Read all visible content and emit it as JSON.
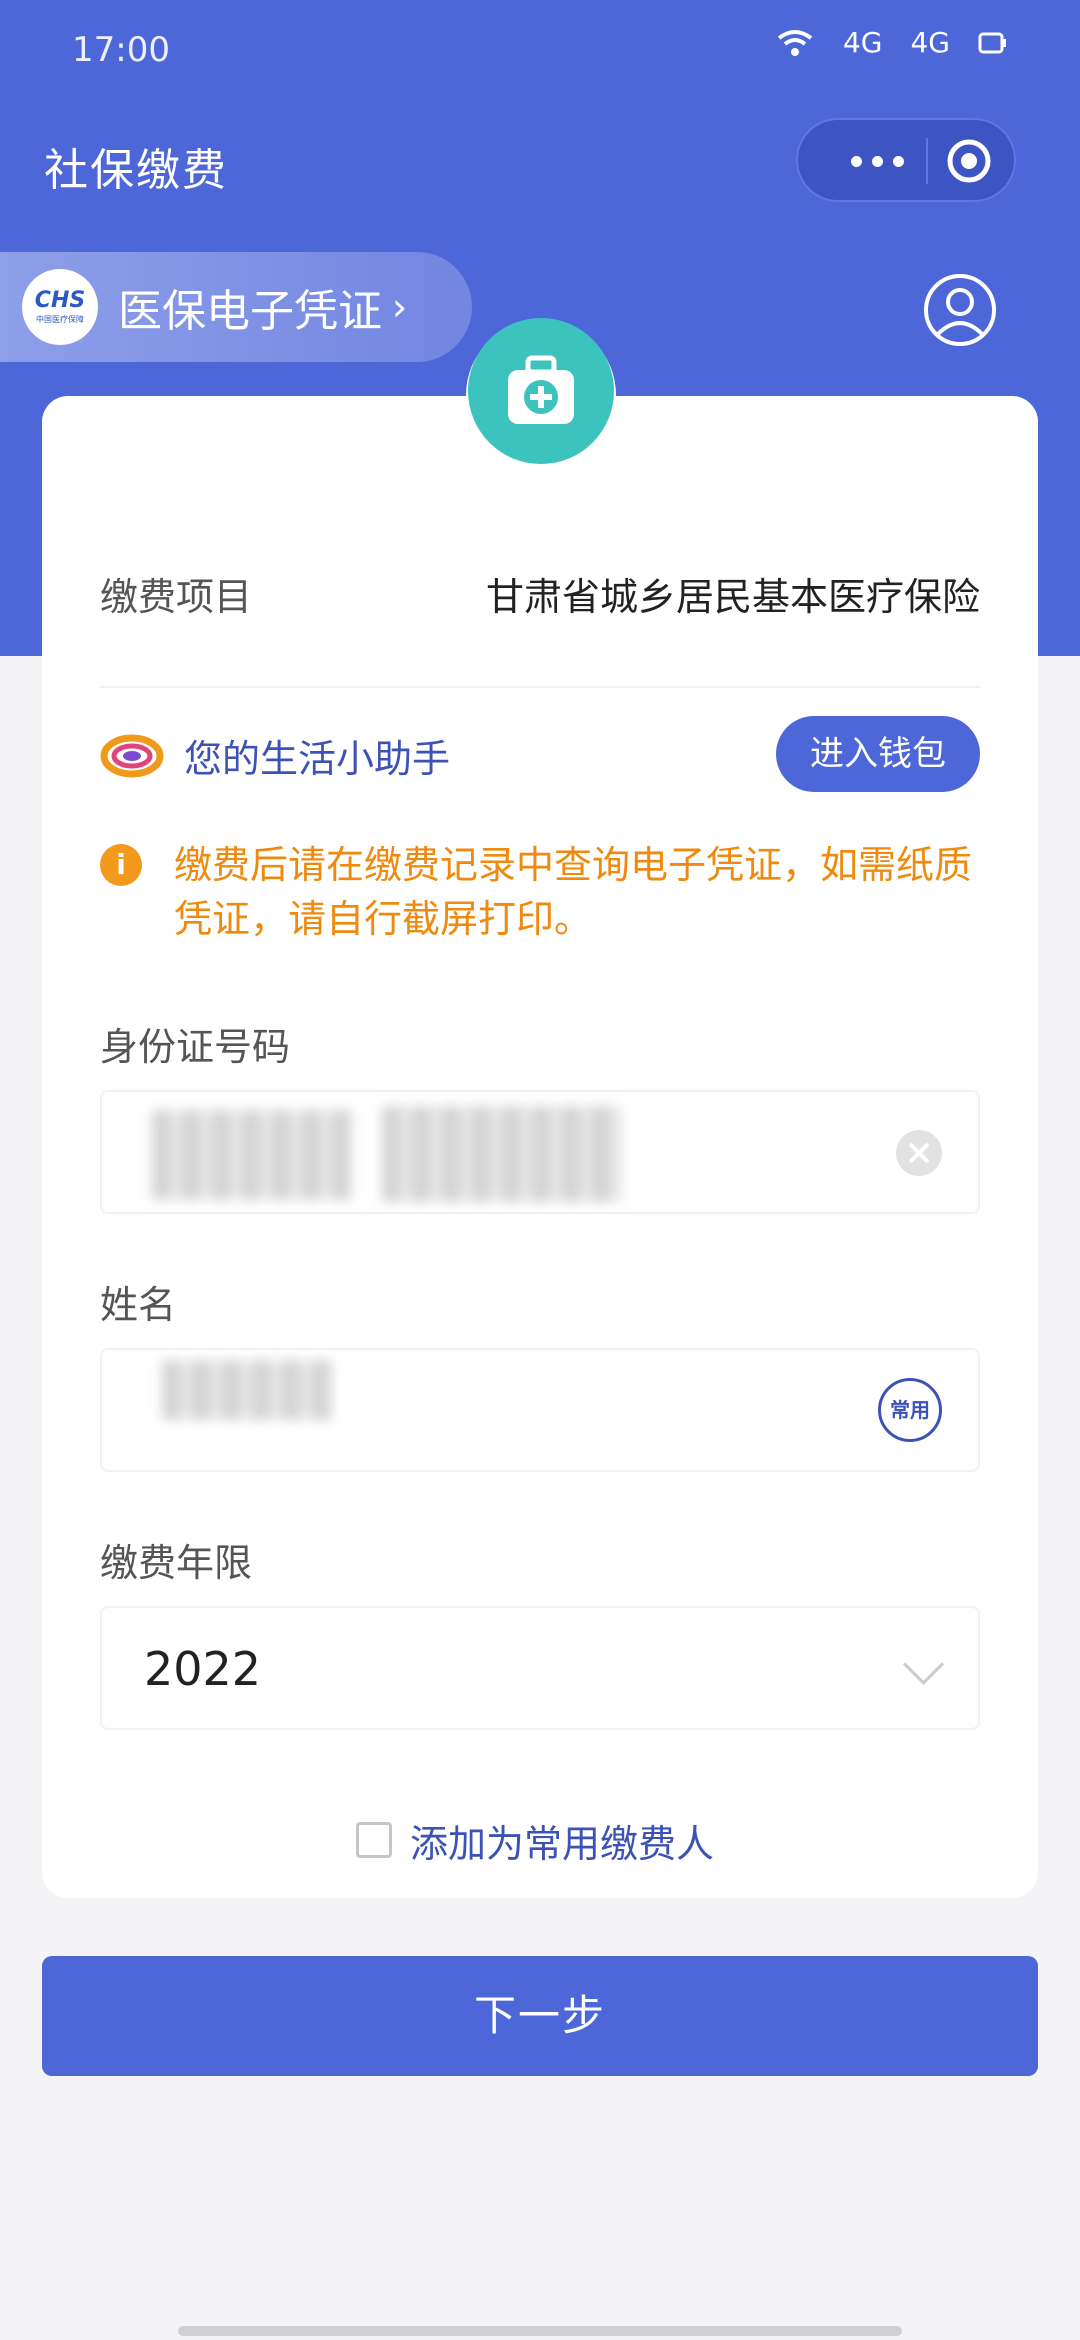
{
  "status_bar": {
    "time": "17:00",
    "signal_1": "4G",
    "signal_2": "4G"
  },
  "header": {
    "title": "社保缴费",
    "more_label": "更多",
    "close_label": "关闭"
  },
  "cert_banner": {
    "logo_text": "CHS",
    "logo_sub": "中国医疗保障",
    "label": "医保电子凭证",
    "arrow": "›"
  },
  "form": {
    "item_label": "缴费项目",
    "item_value": "甘肃省城乡居民基本医疗保险",
    "assistant_name": "您的生活小助手",
    "wallet_button": "进入钱包",
    "notice_icon": "i",
    "notice_text": "缴费后请在缴费记录中查询电子凭证，如需纸质凭证，请自行截屏打印。",
    "id_label": "身份证号码",
    "name_label": "姓名",
    "common_icon_text": "常用",
    "year_label": "缴费年限",
    "year_value": "2022",
    "add_common_label": "添加为常用缴费人"
  },
  "next_button": "下一步",
  "colors": {
    "primary": "#4d67d8",
    "teal": "#3cc3be",
    "warning": "#ef8a0e"
  }
}
